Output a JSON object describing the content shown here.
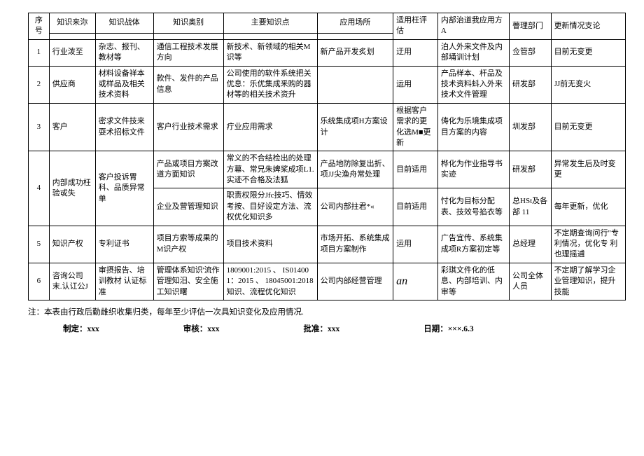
{
  "headers": {
    "seq": "序号",
    "source": "知识来沵",
    "carrier": "知识战体",
    "category": "知识奥别",
    "keypoints": "主要知识点",
    "scene": "应用场所",
    "eval": "适用枉评估",
    "internal": "内部治道我应用方A",
    "dept": "瞢理部门",
    "update": "更新情况支论"
  },
  "rows": [
    {
      "seq": "1",
      "source": "行业泼至",
      "carrier": "杂志、报刊、教材等",
      "category": "通信工程技术发展方向",
      "keypoints": "新技术、新领域的相关M识等",
      "scene": "新产品开发炙划",
      "eval": "迂用",
      "internal": "泊人外来文件及内部埇训计划",
      "dept": "佥管部",
      "update": "目前无变更"
    },
    {
      "seq": "2",
      "source": "供应商",
      "carrier": "材料设备祥本或样品及相关技术资料",
      "category": "款件、发件的产品信息",
      "keypoints": "公司使用的软件系统把关优息：乐优集成釆购的器材等的相关技术资升",
      "scene": "",
      "eval": "运用",
      "internal": "产品样本、杆品及技术资料蚪入外来技术文件管理",
      "dept": "研发部",
      "update": "JJ前无变火"
    },
    {
      "seq": "3",
      "source": "客户",
      "carrier": "密求文件技来耍术招标文件",
      "category": "客户行业技术需求",
      "keypoints": "疔业应用需求",
      "scene": "乐统集成项H方案设计",
      "eval": "根据客户需求的更化选M■更新",
      "internal": "俦化为乐境集成项目方案的内容",
      "dept": "圳发部",
      "update": "目前无变更"
    },
    {
      "seq": "4",
      "source": "内部成功枉验戓失",
      "carrier": "客户投诉胃科、品质异常单",
      "sub": [
        {
          "category": "产品或项目方案改道方面知识",
          "keypoints": "常义的不合结检出的处理方幕、常兄朱婢桨成项L1.实迹不合格及法狐",
          "scene": "产品地防除复出折、项JJ尖渔舟常处理",
          "eval": "目前适用",
          "internal": "桦化为作业指导书实迹",
          "dept": "研发部",
          "update": "异常发生后及时变更"
        },
        {
          "category": "企业及营管理知识",
          "keypoints": "职责权限分Jfc技巧、情效考按、目好设定方法、流权优化知识多",
          "scene": "公司内部拄君*«",
          "eval": "目前适用",
          "internal": "忖化为目标分配表、技效号掐衣等",
          "dept": "总HSt及各部\n11",
          "update": "每年更新，优化"
        }
      ]
    },
    {
      "seq": "5",
      "source": "知识产权",
      "carrier": "专利证书",
      "category": "项目方索等成果的M识产权",
      "keypoints": "项目技术资料",
      "scene": "市场开拓、系统集成项目方案制作",
      "eval": "运用",
      "internal": "广告宜传、系统集成项R方案初定等",
      "dept": "总经理",
      "update": "不定期查询问行\"专利情况，优化专\n利也理摇逋"
    },
    {
      "seq": "6",
      "source": "咨询公司末.认讧公J",
      "carrier": "审摂报告、培训教材\n认证标准",
      "category": "管理体系知识'流作管理知汨、安全施工知识曙",
      "keypoints": "1809001:2015\t、\nIS014001：2015\t、\n18045001:2018知识、流程优化知识",
      "scene": "公司内邰经营管理",
      "eval_html": "an",
      "internal": "彩琪文件化的低息、内部培训、内审等",
      "dept": "公司全体人员",
      "update": "不定期了解学习企业管理知识，提升技能"
    }
  ],
  "note": "注：本表由行政后勤雌织收集归类，每年至少评估一次具知识变化及应用情况.",
  "sig": {
    "make_label": "制定：",
    "make_val": "xxx",
    "review_label": "审核：",
    "review_val": "xxx",
    "approve_label": "批准：",
    "approve_val": "xxx",
    "date_label": "日期：",
    "date_val": "×××.6.3"
  }
}
